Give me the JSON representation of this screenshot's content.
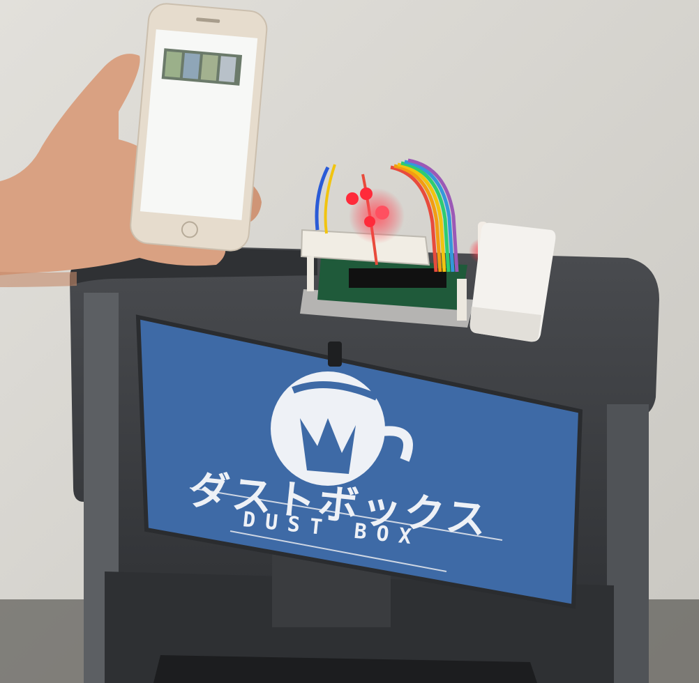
{
  "sign": {
    "japanese_text": "ダストボックス",
    "english_text": "DUST BOX"
  },
  "colors": {
    "wall": "#d9d7d2",
    "bin_body": "#3b3d40",
    "sign_blue": "#3e6aa6",
    "sign_text": "#eef1f6",
    "led_red": "#ff2a3a",
    "phone_gold": "#e6dccd"
  },
  "objects": [
    "hand-holding-phone",
    "smartphone",
    "breadboard-with-leds",
    "raspberry-pi-board",
    "white-sensor-box",
    "dust-box-bin"
  ]
}
